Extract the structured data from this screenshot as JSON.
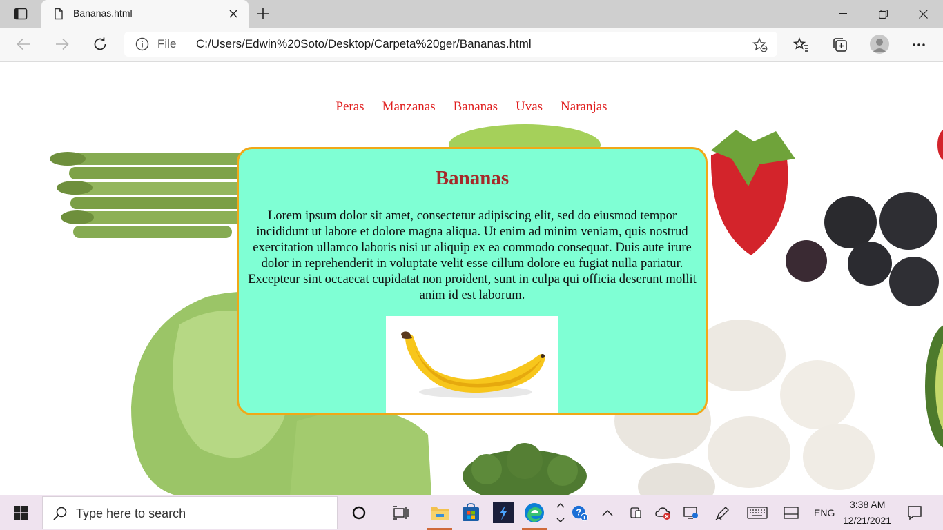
{
  "browser": {
    "tab_title": "Bananas.html",
    "address_scheme": "File",
    "address_url": "C:/Users/Edwin%20Soto/Desktop/Carpeta%20ger/Bananas.html"
  },
  "page": {
    "nav_links": [
      "Peras",
      "Manzanas",
      "Bananas",
      "Uvas",
      "Naranjas"
    ],
    "card_title": "Bananas",
    "card_text": "Lorem ipsum dolor sit amet, consectetur adipiscing elit, sed do eiusmod tempor incididunt ut labore et dolore magna aliqua. Ut enim ad minim veniam, quis nostrud exercitation ullamco laboris nisi ut aliquip ex ea commodo consequat. Duis aute irure dolor in reprehenderit in voluptate velit esse cillum dolore eu fugiat nulla pariatur. Excepteur sint occaecat cupidatat non proident, sunt in culpa qui officia deserunt mollit anim id est laborum."
  },
  "taskbar": {
    "search_placeholder": "Type here to search",
    "language": "ENG",
    "time": "3:38 AM",
    "date": "12/21/2021"
  },
  "colors": {
    "nav_link": "#e01e1e",
    "card_bg": "#7fffd4",
    "card_border": "#f0a818",
    "card_title": "#a52a2a"
  }
}
